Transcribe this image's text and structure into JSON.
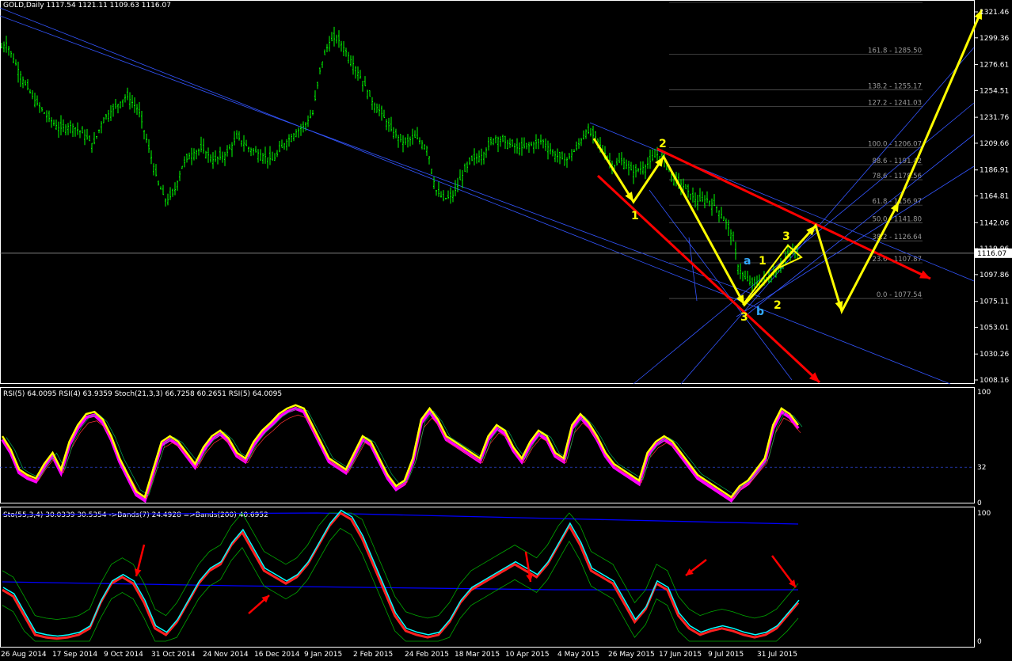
{
  "main_header": "GOLD,Daily  1117.54 1121.11 1109.63 1116.07",
  "rsi_header": "RSI(5) 64.0095  RSI(4) 63.9359  Stoch(21,3,3) 66.7258 60.2651  RSI(5) 64.0095",
  "sto_header": "Sto(55,3,4) 30.0339 30.5354  ->Bands(7) 24.4928  =>Bands(200) 40.6952",
  "current_price": "1116.07",
  "colors": {
    "up_bar": "#00ff00",
    "trendline": "#3355ff",
    "projection": "#ffff00",
    "arrow_red": "#ff0000",
    "rsi_main": "#ffff00",
    "rsi_shadow": "#ff00ff",
    "sto_main": "#ff2020",
    "sto_signal": "#00ffff",
    "bands": "#00aa00",
    "bands200": "#0000ff"
  },
  "chart_data": [
    {
      "type": "candlestick",
      "symbol": "GOLD",
      "timeframe": "Daily",
      "ylim": [
        1008.16,
        1321.46
      ],
      "yticks": [
        "1321.46",
        "1299.36",
        "1276.61",
        "1254.51",
        "1231.76",
        "1209.66",
        "1186.91",
        "1164.81",
        "1142.06",
        "1119.96",
        "1097.86",
        "1075.11",
        "1053.01",
        "1030.26",
        "1008.16"
      ],
      "xticks": [
        "26 Aug 2014",
        "17 Sep 2014",
        "9 Oct 2014",
        "31 Oct 2014",
        "24 Nov 2014",
        "16 Dec 2014",
        "9 Jan 2015",
        "2 Feb 2015",
        "24 Feb 2015",
        "18 Mar 2015",
        "10 Apr 2015",
        "4 May 2015",
        "26 May 2015",
        "17 Jun 2015",
        "9 Jul 2015",
        "31 Jul 2015"
      ],
      "close_path": [
        [
          0,
          1290
        ],
        [
          8,
          1295
        ],
        [
          18,
          1280
        ],
        [
          30,
          1262
        ],
        [
          45,
          1245
        ],
        [
          60,
          1232
        ],
        [
          75,
          1222
        ],
        [
          90,
          1225
        ],
        [
          105,
          1218
        ],
        [
          118,
          1208
        ],
        [
          130,
          1230
        ],
        [
          145,
          1240
        ],
        [
          160,
          1250
        ],
        [
          175,
          1238
        ],
        [
          190,
          1200
        ],
        [
          200,
          1175
        ],
        [
          210,
          1160
        ],
        [
          220,
          1168
        ],
        [
          230,
          1190
        ],
        [
          240,
          1200
        ],
        [
          255,
          1205
        ],
        [
          270,
          1195
        ],
        [
          285,
          1200
        ],
        [
          300,
          1215
        ],
        [
          315,
          1205
        ],
        [
          330,
          1200
        ],
        [
          345,
          1195
        ],
        [
          360,
          1210
        ],
        [
          375,
          1220
        ],
        [
          385,
          1225
        ],
        [
          395,
          1235
        ],
        [
          405,
          1275
        ],
        [
          415,
          1295
        ],
        [
          425,
          1300
        ],
        [
          435,
          1290
        ],
        [
          448,
          1275
        ],
        [
          460,
          1260
        ],
        [
          470,
          1245
        ],
        [
          482,
          1235
        ],
        [
          495,
          1220
        ],
        [
          510,
          1210
        ],
        [
          525,
          1215
        ],
        [
          540,
          1205
        ],
        [
          550,
          1170
        ],
        [
          560,
          1162
        ],
        [
          572,
          1165
        ],
        [
          582,
          1180
        ],
        [
          595,
          1195
        ],
        [
          610,
          1200
        ],
        [
          625,
          1215
        ],
        [
          640,
          1210
        ],
        [
          655,
          1205
        ],
        [
          670,
          1208
        ],
        [
          685,
          1212
        ],
        [
          700,
          1200
        ],
        [
          715,
          1195
        ],
        [
          728,
          1205
        ],
        [
          740,
          1220
        ],
        [
          752,
          1215
        ],
        [
          765,
          1200
        ],
        [
          775,
          1190
        ],
        [
          785,
          1195
        ],
        [
          800,
          1185
        ],
        [
          815,
          1190
        ],
        [
          830,
          1200
        ],
        [
          840,
          1195
        ],
        [
          850,
          1180
        ],
        [
          860,
          1175
        ],
        [
          870,
          1168
        ],
        [
          880,
          1160
        ],
        [
          893,
          1162
        ],
        [
          905,
          1155
        ],
        [
          915,
          1145
        ],
        [
          925,
          1130
        ],
        [
          932,
          1105
        ],
        [
          940,
          1095
        ],
        [
          950,
          1090
        ],
        [
          960,
          1092
        ],
        [
          970,
          1095
        ],
        [
          980,
          1100
        ],
        [
          990,
          1110
        ],
        [
          1000,
          1118
        ],
        [
          1008,
          1115
        ]
      ],
      "fibonacci": [
        {
          "level": "0.0",
          "price": "1077.54"
        },
        {
          "level": "23.6",
          "price": "1107.87"
        },
        {
          "level": "38.2",
          "price": "1126.64"
        },
        {
          "level": "50.0",
          "price": "1141.80"
        },
        {
          "level": "61.8",
          "price": "1156.97"
        },
        {
          "level": "78.6",
          "price": "1178.56"
        },
        {
          "level": "88.6",
          "price": "1191.42"
        },
        {
          "level": "100.0",
          "price": "1206.07"
        },
        {
          "level": "127.2",
          "price": "1241.03"
        },
        {
          "level": "138.2",
          "price": "1255.17"
        },
        {
          "level": "161.8",
          "price": "1285.50"
        }
      ],
      "wave_labels": [
        {
          "text": "1",
          "color": "#ffff00"
        },
        {
          "text": "2",
          "color": "#ffff00"
        },
        {
          "text": "3",
          "color": "#ffff00"
        },
        {
          "text": "a",
          "color": "#33aaff"
        },
        {
          "text": "b",
          "color": "#33aaff"
        },
        {
          "text": "1",
          "color": "#ffff00"
        },
        {
          "text": "2",
          "color": "#ffff00"
        },
        {
          "text": "3",
          "color": "#ffff00"
        }
      ]
    },
    {
      "type": "line",
      "panel": "RSI / Stoch",
      "ylim": [
        0,
        100
      ],
      "yticks": [
        "100",
        "32",
        "0"
      ],
      "level_line": 32,
      "series": [
        {
          "name": "RSI(5)",
          "values_approx": [
            60,
            48,
            30,
            25,
            22,
            35,
            45,
            30,
            55,
            70,
            80,
            82,
            75,
            60,
            40,
            25,
            10,
            5,
            30,
            55,
            60,
            55,
            45,
            35,
            50,
            60,
            65,
            58,
            45,
            40,
            55,
            65,
            72,
            80,
            85,
            88,
            85,
            70,
            55,
            40,
            35,
            30,
            45,
            60,
            55,
            40,
            25,
            15,
            20,
            40,
            75,
            85,
            75,
            60,
            55,
            50,
            45,
            40,
            60,
            70,
            65,
            50,
            40,
            55,
            65,
            60,
            45,
            40,
            70,
            80,
            72,
            60,
            45,
            35,
            30,
            25,
            20,
            45,
            55,
            60,
            55,
            45,
            35,
            25,
            20,
            15,
            10,
            5,
            15,
            20,
            30,
            40,
            70,
            85,
            80,
            70
          ]
        }
      ]
    },
    {
      "type": "line",
      "panel": "Stochastic / Bands",
      "ylim": [
        0,
        100
      ],
      "yticks": [
        "100",
        "0"
      ],
      "series": [
        {
          "name": "Sto(55,3,4)",
          "values_approx": [
            40,
            35,
            20,
            5,
            3,
            2,
            3,
            5,
            10,
            30,
            45,
            50,
            45,
            30,
            10,
            5,
            15,
            30,
            45,
            55,
            60,
            75,
            85,
            70,
            55,
            50,
            45,
            50,
            60,
            75,
            90,
            100,
            95,
            80,
            60,
            40,
            20,
            8,
            5,
            3,
            5,
            15,
            30,
            40,
            45,
            50,
            55,
            60,
            55,
            50,
            60,
            75,
            90,
            75,
            55,
            50,
            45,
            30,
            15,
            25,
            45,
            40,
            20,
            10,
            5,
            8,
            10,
            8,
            5,
            3,
            5,
            10,
            20,
            30
          ]
        }
      ]
    }
  ]
}
